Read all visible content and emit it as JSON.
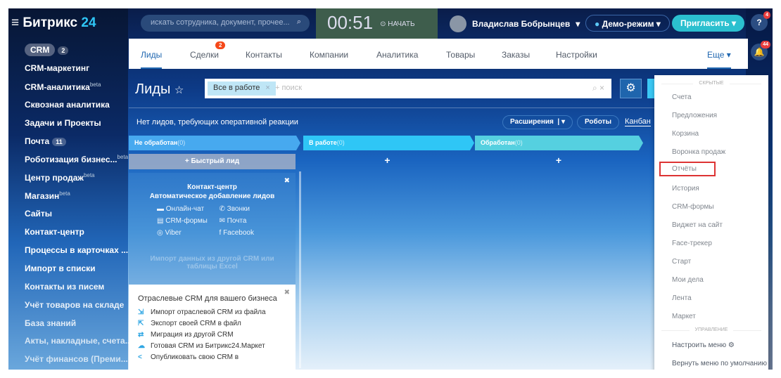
{
  "app": {
    "logo_main": "Битрикс",
    "logo_num": "24"
  },
  "header": {
    "search_placeholder": "искать сотрудника, документ, прочее...",
    "timer": "00:51",
    "start_label": "НАЧАТЬ",
    "user_name": "Владислав Бобрынцев",
    "demo_label": "Демо-режим",
    "invite_label": "Пригласить",
    "help_badge": "4",
    "notif_badge": "44"
  },
  "sidebar": {
    "items": [
      {
        "label": "CRM",
        "count": "2"
      },
      {
        "label": "CRM-маркетинг"
      },
      {
        "label": "CRM-аналитика",
        "sup": "beta"
      },
      {
        "label": "Сквозная аналитика"
      },
      {
        "label": "Задачи и Проекты"
      },
      {
        "label": "Почта",
        "count": "11"
      },
      {
        "label": "Роботизация бизнес...",
        "sup": "beta"
      },
      {
        "label": "Центр продаж",
        "sup": "beta"
      },
      {
        "label": "Магазин",
        "sup": "beta"
      },
      {
        "label": "Сайты"
      },
      {
        "label": "Контакт-центр"
      },
      {
        "label": "Процессы в карточках ..."
      },
      {
        "label": "Импорт в списки"
      },
      {
        "label": "Контакты из писем"
      },
      {
        "label": "Учёт товаров на складе"
      },
      {
        "label": "База знаний"
      },
      {
        "label": "Акты, накладные, счета..."
      },
      {
        "label": "Учёт финансов (Преми..."
      }
    ]
  },
  "tabs": [
    {
      "label": "Лиды"
    },
    {
      "label": "Сделки",
      "badge": "2"
    },
    {
      "label": "Контакты"
    },
    {
      "label": "Компании"
    },
    {
      "label": "Аналитика"
    },
    {
      "label": "Товары"
    },
    {
      "label": "Заказы"
    },
    {
      "label": "Настройки"
    },
    {
      "label": "Еще"
    }
  ],
  "page": {
    "title": "Лиды",
    "filter_chip": "Все в работе",
    "filter_placeholder": "+ поиск",
    "info": "Нет лидов, требующих оперативной реакции",
    "extensions": "Расширения",
    "robots": "Роботы",
    "kanban": "Канбан"
  },
  "columns": [
    {
      "title": "Не обработан",
      "count": "(0)",
      "color": "#47a9ef"
    },
    {
      "title": "В работе",
      "count": "(0)",
      "color": "#2fc6f6"
    },
    {
      "title": "Обработан",
      "count": "(0)",
      "color": "#55d0e0"
    }
  ],
  "quick_lead": "+ Быстрый лид",
  "contact_center": {
    "title": "Контакт-центр",
    "subtitle": "Автоматическое добавление лидов",
    "channels": [
      "Онлайн-чат",
      "Звонки",
      "CRM-формы",
      "Почта",
      "Viber",
      "Facebook"
    ],
    "import": "Импорт данных из другой CRM или таблицы Excel"
  },
  "industry": {
    "title": "Отраслевые CRM для вашего бизнеса",
    "items": [
      "Импорт отраслевой CRM из файла",
      "Экспорт своей CRM в файл",
      "Миграция из другой CRM",
      "Готовая CRM из Битрикс24.Маркет",
      "Опубликовать свою CRM в"
    ]
  },
  "dropdown": {
    "hidden_header": "СКРЫТЫЕ",
    "items": [
      "Счета",
      "Предложения",
      "Корзина",
      "Воронка продаж",
      "Отчёты",
      "История",
      "CRM-формы",
      "Виджет на сайт",
      "Face-трекер",
      "Старт",
      "Мои дела",
      "Лента",
      "Маркет"
    ],
    "manage_header": "УПРАВЛЕНИЕ",
    "configure": "Настроить меню",
    "reset": "Вернуть меню по умолчанию"
  }
}
